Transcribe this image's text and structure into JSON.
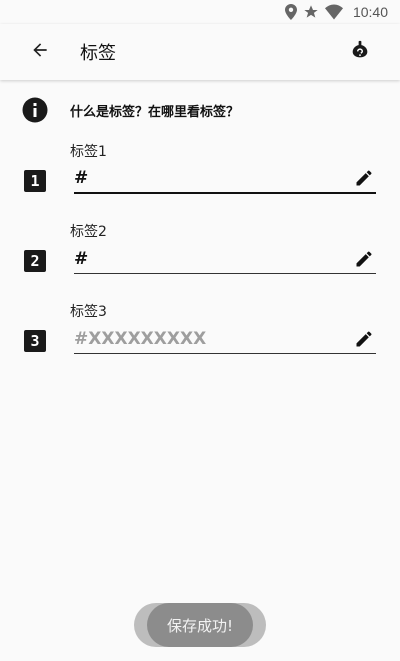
{
  "status_bar": {
    "time": "10:40",
    "icons": [
      "location-icon",
      "star-icon",
      "wifi-icon"
    ]
  },
  "app_bar": {
    "title": "标签",
    "back_icon": "arrow-back-icon",
    "help_icon": "help-icon"
  },
  "info": {
    "icon": "info-icon",
    "text": "什么是标签？在哪里看标签？"
  },
  "tags": [
    {
      "number": "1",
      "label": "标签1",
      "value": "#",
      "placeholder": ""
    },
    {
      "number": "2",
      "label": "标签2",
      "value": "#",
      "placeholder": ""
    },
    {
      "number": "3",
      "label": "标签3",
      "value": "",
      "placeholder": "#XXXXXXXXX"
    }
  ],
  "toast": {
    "text": "保存成功!"
  }
}
